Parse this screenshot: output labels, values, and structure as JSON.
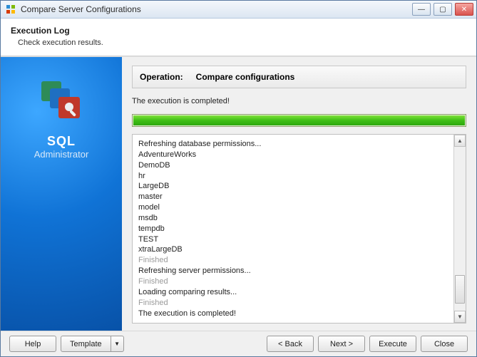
{
  "window": {
    "title": "Compare Server Configurations"
  },
  "header": {
    "title": "Execution Log",
    "subtitle": "Check execution results."
  },
  "sidebar": {
    "brand_line1": "SQL",
    "brand_line2": "Administrator"
  },
  "operation": {
    "label": "Operation:",
    "value": "Compare configurations"
  },
  "status_message": "The execution is completed!",
  "progress": {
    "percent": 100
  },
  "log": {
    "lines": [
      {
        "text": "Refreshing database permissions...",
        "style": "normal"
      },
      {
        "text": "AdventureWorks",
        "style": "normal"
      },
      {
        "text": "DemoDB",
        "style": "normal"
      },
      {
        "text": "hr",
        "style": "normal"
      },
      {
        "text": "LargeDB",
        "style": "normal"
      },
      {
        "text": "master",
        "style": "normal"
      },
      {
        "text": "model",
        "style": "normal"
      },
      {
        "text": "msdb",
        "style": "normal"
      },
      {
        "text": "tempdb",
        "style": "normal"
      },
      {
        "text": "TEST",
        "style": "normal"
      },
      {
        "text": "xtraLargeDB",
        "style": "normal"
      },
      {
        "text": "Finished",
        "style": "finished"
      },
      {
        "text": "Refreshing server permissions...",
        "style": "normal"
      },
      {
        "text": "Finished",
        "style": "finished"
      },
      {
        "text": "Loading comparing results...",
        "style": "normal"
      },
      {
        "text": "Finished",
        "style": "finished"
      },
      {
        "text": "The execution is completed!",
        "style": "normal"
      }
    ]
  },
  "footer": {
    "help": "Help",
    "template": "Template",
    "back": "< Back",
    "next": "Next >",
    "execute": "Execute",
    "close": "Close"
  }
}
